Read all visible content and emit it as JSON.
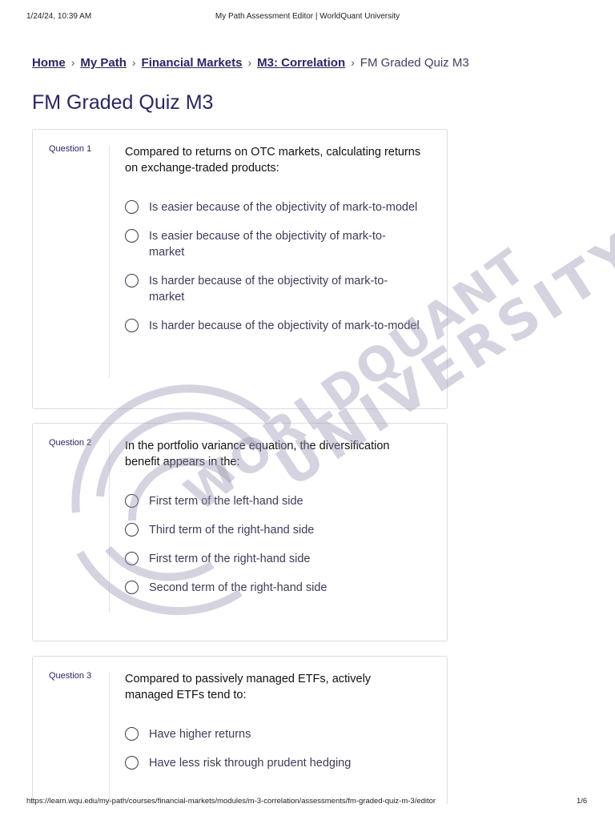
{
  "print_header": {
    "date": "1/24/24, 10:39 AM",
    "title": "My Path Assessment Editor | WorldQuant University"
  },
  "breadcrumb": {
    "items": [
      "Home",
      "My Path",
      "Financial Markets",
      "M3: Correlation"
    ],
    "current": "FM Graded Quiz M3"
  },
  "page_title": "FM Graded Quiz M3",
  "questions": [
    {
      "label": "Question 1",
      "text": "Compared to returns on OTC markets, calculating returns on exchange-traded products:",
      "options": [
        "Is easier because of the objectivity of mark-to-model",
        "Is easier because of the objectivity of mark-to-market",
        "Is harder because of the objectivity of mark-to-market",
        "Is harder because of the objectivity of mark-to-model"
      ]
    },
    {
      "label": "Question 2",
      "text": "In the portfolio variance equation, the diversification benefit appears in the:",
      "options": [
        "First term of the left-hand side",
        "Third term of the right-hand side",
        "First term of the right-hand side",
        "Second term of the right-hand side"
      ]
    },
    {
      "label": "Question 3",
      "text": "Compared to passively managed ETFs, actively managed ETFs tend to:",
      "options": [
        "Have higher returns",
        "Have less risk through prudent hedging"
      ]
    }
  ],
  "watermark": {
    "line1": "WORLDQUANT",
    "line2": "UNIVERSITY",
    "color": "#9a98b4"
  },
  "print_footer": {
    "url": "https://learn.wqu.edu/my-path/courses/financial-markets/modules/m-3-correlation/assessments/fm-graded-quiz-m-3/editor",
    "page": "1/6"
  }
}
